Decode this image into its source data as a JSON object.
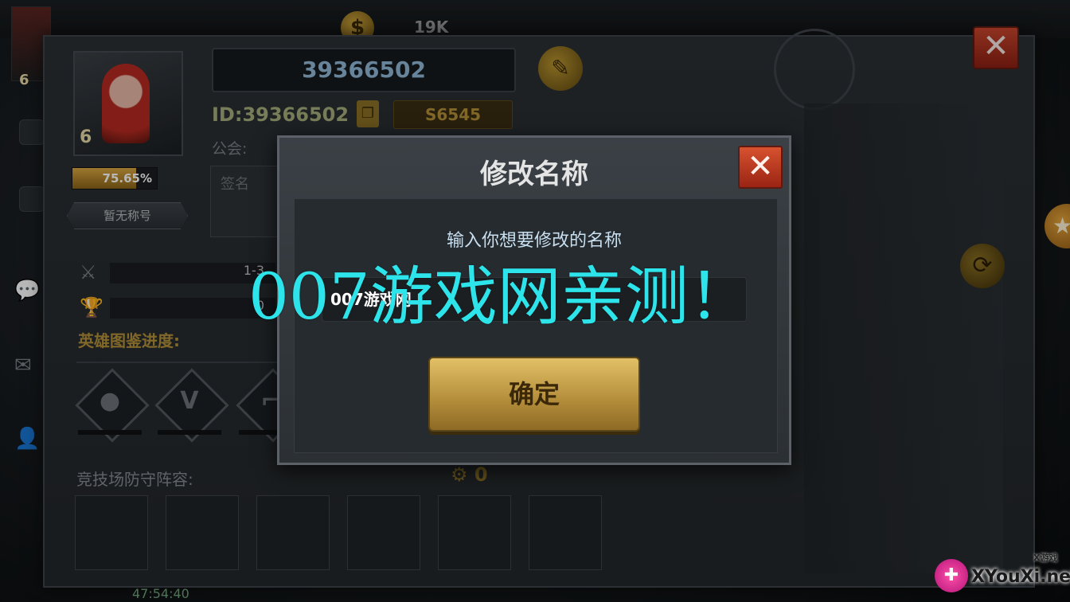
{
  "hud": {
    "coin_value": "19K",
    "corner_level": "6"
  },
  "profile": {
    "name": "39366502",
    "id_text": "ID:39366502",
    "server": "S6545",
    "guild_label": "公会:",
    "signature_label": "签名",
    "level": "6",
    "exp_percent_text": "75.65%",
    "exp_fraction": 0.7565,
    "title_tag": "暂无称号",
    "stats": [
      {
        "icon": "crossed-swords-icon",
        "value": "1-3"
      },
      {
        "icon": "trophy-icon",
        "value": "0"
      }
    ],
    "collection_label": "英雄图鉴进度:",
    "hero_slots": [
      "person-icon",
      "v-rank-icon",
      "gun-icon"
    ],
    "arena_label": "竞技场防守阵容:",
    "arena_power": "0",
    "timer": "47:54:40"
  },
  "dialog": {
    "title": "修改名称",
    "prompt": "输入你想要修改的名称",
    "input_value": "007游戏网",
    "confirm_label": "确定"
  },
  "overlay": {
    "watermark": "007游戏网亲测！",
    "site_name": "XYouXi.net",
    "site_sub": "X游戏"
  },
  "colors": {
    "accent_gold": "#b3903a",
    "close_red": "#c7452d",
    "watermark_cyan": "#2de4ea"
  }
}
